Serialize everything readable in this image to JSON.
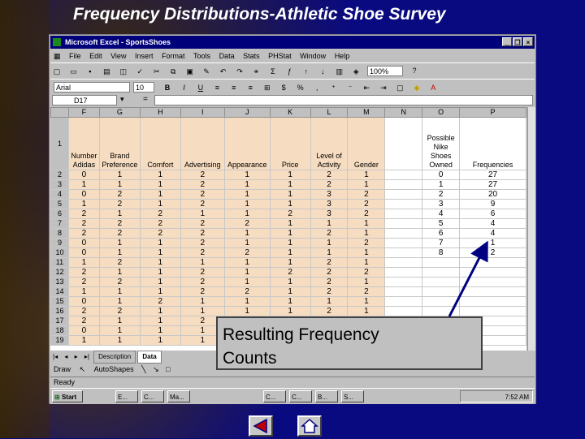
{
  "slide": {
    "title": "Frequency Distributions-Athletic Shoe Survey",
    "callout_line1": "Resulting Frequency",
    "callout_line2": "Counts"
  },
  "excel": {
    "app_title": "Microsoft Excel - SportsShoes",
    "menu": [
      "File",
      "Edit",
      "View",
      "Insert",
      "Format",
      "Tools",
      "Data",
      "Stats",
      "PHStat",
      "Window",
      "Help"
    ],
    "font_name": "Arial",
    "font_size": "10",
    "zoom": "100%",
    "name_box": "D17",
    "formula_eq": "=",
    "columns": [
      "F",
      "G",
      "H",
      "I",
      "J",
      "K",
      "L",
      "M",
      "N",
      "O",
      "P"
    ],
    "header_row_label": "1",
    "headers": [
      "Number Adidas",
      "Brand Preference",
      "Comfort",
      "Advertising",
      "Appearance",
      "Price",
      "Level of Activity",
      "Gender",
      "",
      "Possible Nike Shoes Owned",
      "Frequencies"
    ],
    "rows": [
      {
        "r": "2",
        "c": [
          "0",
          "1",
          "1",
          "2",
          "1",
          "1",
          "2",
          "1",
          "",
          "0",
          "27"
        ]
      },
      {
        "r": "3",
        "c": [
          "1",
          "1",
          "1",
          "2",
          "1",
          "1",
          "2",
          "1",
          "",
          "1",
          "27"
        ]
      },
      {
        "r": "4",
        "c": [
          "0",
          "2",
          "1",
          "2",
          "1",
          "1",
          "3",
          "2",
          "",
          "2",
          "20"
        ]
      },
      {
        "r": "5",
        "c": [
          "1",
          "2",
          "1",
          "2",
          "1",
          "1",
          "3",
          "2",
          "",
          "3",
          "9"
        ]
      },
      {
        "r": "6",
        "c": [
          "2",
          "1",
          "2",
          "1",
          "1",
          "2",
          "3",
          "2",
          "",
          "4",
          "6"
        ]
      },
      {
        "r": "7",
        "c": [
          "2",
          "2",
          "2",
          "2",
          "2",
          "1",
          "1",
          "1",
          "",
          "5",
          "4"
        ]
      },
      {
        "r": "8",
        "c": [
          "2",
          "2",
          "2",
          "2",
          "1",
          "1",
          "2",
          "1",
          "",
          "6",
          "4"
        ]
      },
      {
        "r": "9",
        "c": [
          "0",
          "1",
          "1",
          "2",
          "1",
          "1",
          "1",
          "2",
          "",
          "7",
          "1"
        ]
      },
      {
        "r": "10",
        "c": [
          "0",
          "1",
          "1",
          "2",
          "2",
          "1",
          "1",
          "1",
          "",
          "8",
          "2"
        ]
      },
      {
        "r": "11",
        "c": [
          "1",
          "2",
          "1",
          "1",
          "1",
          "1",
          "2",
          "1",
          "",
          "",
          ""
        ]
      },
      {
        "r": "12",
        "c": [
          "2",
          "1",
          "1",
          "2",
          "1",
          "2",
          "2",
          "2",
          "",
          "",
          ""
        ]
      },
      {
        "r": "13",
        "c": [
          "2",
          "2",
          "1",
          "2",
          "1",
          "1",
          "2",
          "1",
          "",
          "",
          ""
        ]
      },
      {
        "r": "14",
        "c": [
          "1",
          "1",
          "1",
          "2",
          "2",
          "1",
          "2",
          "2",
          "",
          "",
          ""
        ]
      },
      {
        "r": "15",
        "c": [
          "0",
          "1",
          "2",
          "1",
          "1",
          "1",
          "1",
          "1",
          "",
          "",
          ""
        ]
      },
      {
        "r": "16",
        "c": [
          "2",
          "2",
          "1",
          "1",
          "1",
          "1",
          "2",
          "1",
          "",
          "",
          ""
        ]
      },
      {
        "r": "17",
        "c": [
          "2",
          "1",
          "1",
          "2",
          "",
          "",
          "",
          "",
          "",
          "",
          ""
        ]
      },
      {
        "r": "18",
        "c": [
          "0",
          "1",
          "1",
          "1",
          "",
          "",
          "",
          "",
          "",
          "",
          ""
        ]
      },
      {
        "r": "19",
        "c": [
          "1",
          "1",
          "1",
          "1",
          "",
          "",
          "",
          "",
          "",
          "",
          ""
        ]
      }
    ],
    "sheet_tabs": [
      "Description",
      "Data"
    ],
    "draw_label": "Draw",
    "autoshapes_label": "AutoShapes",
    "status": "Ready",
    "start_label": "Start",
    "tasks": [
      "E...",
      "C...",
      "Ma...",
      "C...",
      "C...",
      "B...",
      "S..."
    ],
    "clock": "7:52 AM"
  }
}
